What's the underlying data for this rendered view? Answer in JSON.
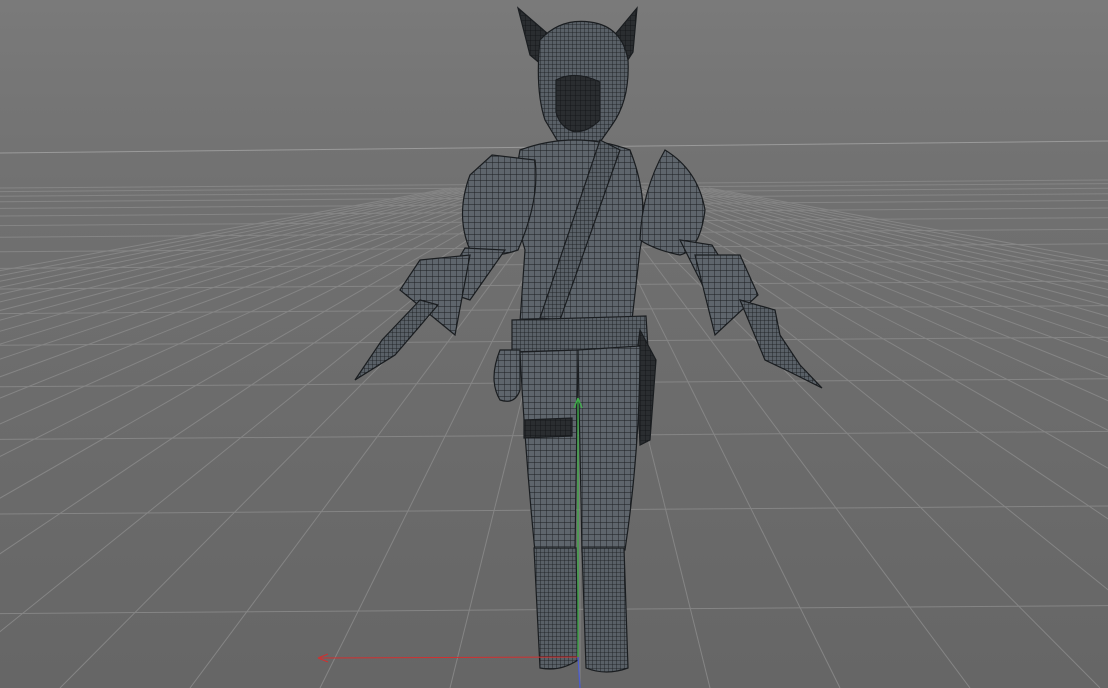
{
  "viewport": {
    "view_mode": "perspective",
    "display_style": "wireframe-on-shaded",
    "background_color": "#6f6f6f",
    "grid_line_color": "#8a8a8a",
    "horizon_color": "#a0a0a0",
    "mesh_color": "#5a6168",
    "wire_color": "#1c1f22"
  },
  "scene": {
    "model_icon": "character-model",
    "axis_gizmo": {
      "x_axis_color": "#d03030",
      "y_axis_color": "#3fb04a",
      "z_axis_color": "#4a5cd0"
    }
  }
}
